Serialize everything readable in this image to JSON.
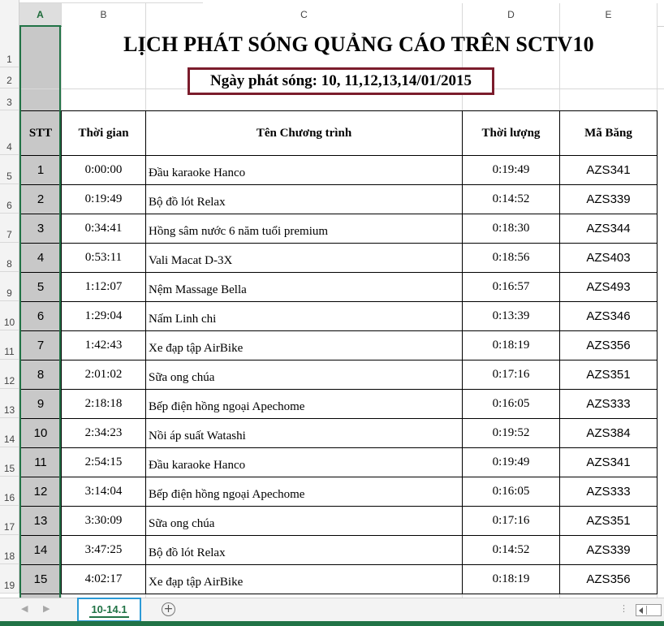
{
  "columns": [
    "A",
    "B",
    "C",
    "D",
    "E"
  ],
  "row_numbers": [
    "1",
    "2",
    "3",
    "4",
    "5",
    "6",
    "7",
    "8",
    "9",
    "10",
    "11",
    "12",
    "13",
    "14",
    "15",
    "16",
    "17",
    "18",
    "19"
  ],
  "title": "LỊCH PHÁT SÓNG QUẢNG CÁO TRÊN SCTV10",
  "date_line": "Ngày phát sóng: 10, 11,12,13,14/01/2015",
  "table": {
    "headers": [
      "STT",
      "Thời gian",
      "Tên Chương trình",
      "Thời lượng",
      "Mã Băng"
    ],
    "rows": [
      [
        "1",
        "0:00:00",
        "Đầu karaoke Hanco",
        "0:19:49",
        "AZS341"
      ],
      [
        "2",
        "0:19:49",
        "Bộ đồ lót Relax",
        "0:14:52",
        "AZS339"
      ],
      [
        "3",
        "0:34:41",
        "Hồng sâm nước 6 năm tuổi premium",
        "0:18:30",
        "AZS344"
      ],
      [
        "4",
        "0:53:11",
        "Vali Macat D-3X",
        "0:18:56",
        "AZS403"
      ],
      [
        "5",
        "1:12:07",
        "Nệm Massage Bella",
        "0:16:57",
        "AZS493"
      ],
      [
        "6",
        "1:29:04",
        "Nấm Linh chi",
        "0:13:39",
        "AZS346"
      ],
      [
        "7",
        "1:42:43",
        "Xe đạp tập AirBike",
        "0:18:19",
        "AZS356"
      ],
      [
        "8",
        "2:01:02",
        "Sữa ong chúa",
        "0:17:16",
        "AZS351"
      ],
      [
        "9",
        "2:18:18",
        "Bếp điện hồng ngoại Apechome",
        "0:16:05",
        "AZS333"
      ],
      [
        "10",
        "2:34:23",
        "Nồi áp suất Watashi",
        "0:19:52",
        "AZS384"
      ],
      [
        "11",
        "2:54:15",
        "Đầu karaoke Hanco",
        "0:19:49",
        "AZS341"
      ],
      [
        "12",
        "3:14:04",
        "Bếp điện hồng ngoại Apechome",
        "0:16:05",
        "AZS333"
      ],
      [
        "13",
        "3:30:09",
        "Sữa ong chúa",
        "0:17:16",
        "AZS351"
      ],
      [
        "14",
        "3:47:25",
        "Bộ đồ lót Relax",
        "0:14:52",
        "AZS339"
      ],
      [
        "15",
        "4:02:17",
        "Xe đạp tập AirBike",
        "0:18:19",
        "AZS356"
      ]
    ]
  },
  "sheet_tabs": [
    "10-14.1"
  ],
  "icons": {
    "prev_sheet": "nav-left-icon",
    "next_sheet": "nav-right-icon",
    "add_sheet": "plus-circle-icon",
    "more": "more-options-icon",
    "scroll_left": "scroll-left-icon"
  },
  "colors": {
    "accent": "#217346",
    "tab_highlight": "#2b9ad6",
    "date_box_border": "#7b1c2c",
    "stt_fill": "#c8c8c8"
  }
}
